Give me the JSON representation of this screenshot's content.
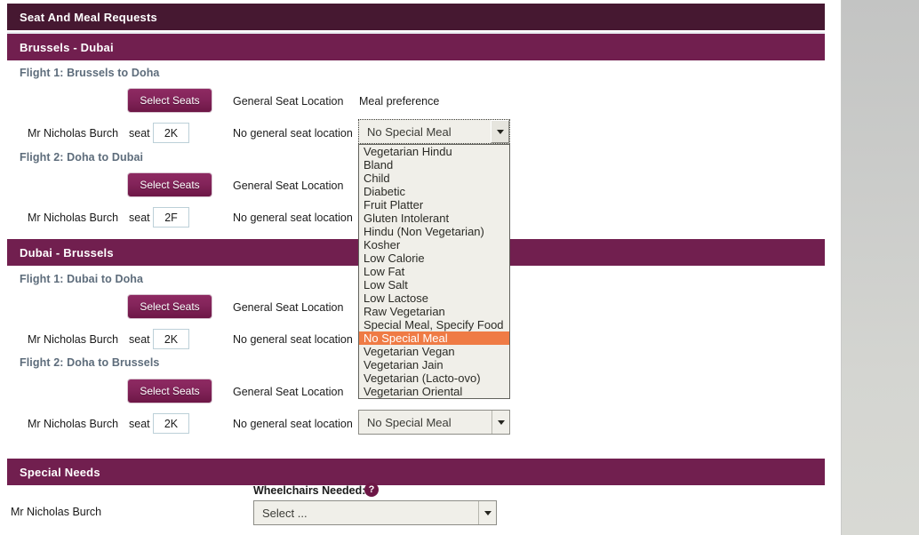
{
  "page": {
    "title": "Seat And Meal Requests"
  },
  "journeys": [
    {
      "title": "Brussels - Dubai",
      "flights": [
        {
          "heading": "Flight 1: Brussels to Doha",
          "select_seats_label": "Select Seats",
          "general_seat_location_label": "General Seat Location",
          "meal_preference_label": "Meal preference",
          "passenger": "Mr Nicholas Burch",
          "seat_word": "seat",
          "seat_value": "2K",
          "seat_location_value": "No general seat location",
          "meal_value": "No Special Meal"
        },
        {
          "heading": "Flight 2: Doha to Dubai",
          "select_seats_label": "Select Seats",
          "general_seat_location_label": "General Seat Location",
          "passenger": "Mr Nicholas Burch",
          "seat_word": "seat",
          "seat_value": "2F",
          "seat_location_value": "No general seat location"
        }
      ]
    },
    {
      "title": "Dubai - Brussels",
      "flights": [
        {
          "heading": "Flight 1: Dubai to Doha",
          "select_seats_label": "Select Seats",
          "general_seat_location_label": "General Seat Location",
          "passenger": "Mr Nicholas Burch",
          "seat_word": "seat",
          "seat_value": "2K",
          "seat_location_value": "No general seat location"
        },
        {
          "heading": "Flight 2: Doha to Brussels",
          "select_seats_label": "Select Seats",
          "general_seat_location_label": "General Seat Location",
          "passenger": "Mr Nicholas Burch",
          "seat_word": "seat",
          "seat_value": "2K",
          "seat_location_value": "No general seat location",
          "meal_value": "No Special Meal"
        }
      ]
    }
  ],
  "meal_dropdown": {
    "selected": "No Special Meal",
    "expanded": true,
    "options": [
      "Vegetarian Hindu",
      "Bland",
      "Child",
      "Diabetic",
      "Fruit Platter",
      "Gluten Intolerant",
      "Hindu (Non Vegetarian)",
      "Kosher",
      "Low Calorie",
      "Low Fat",
      "Low Salt",
      "Low Lactose",
      "Raw Vegetarian",
      "Special Meal, Specify Food",
      "No Special Meal",
      "Vegetarian Vegan",
      "Vegetarian Jain",
      "Vegetarian (Lacto-ovo)",
      "Vegetarian Oriental"
    ]
  },
  "special_needs": {
    "title": "Special Needs",
    "wheelchairs_label": "Wheelchairs Needed:",
    "help_icon_glyph": "?",
    "passenger": "Mr Nicholas Burch",
    "select_value": "Select ..."
  },
  "colors": {
    "title_bar": "#461831",
    "section_bar": "#711f4f",
    "button": "#83245a",
    "highlight": "#ef7b45",
    "flight_heading": "#5d6c7b",
    "panel_grey": "#d4d5d1"
  }
}
